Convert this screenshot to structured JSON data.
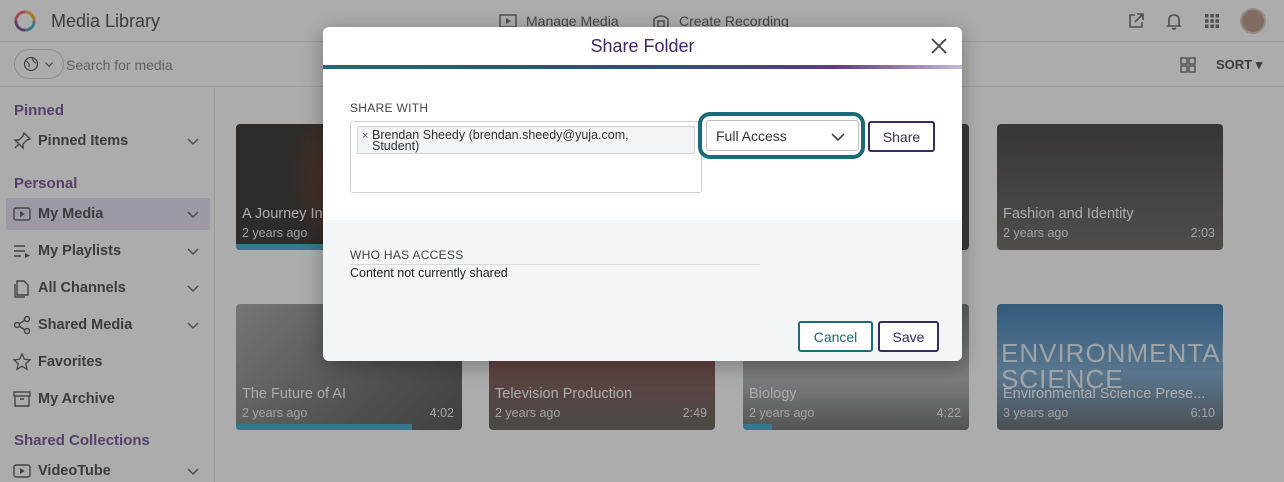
{
  "app": {
    "title": "Media Library",
    "nav": [
      {
        "label": "Manage Media",
        "icon": "manage-media-icon"
      },
      {
        "label": "Create Recording",
        "icon": "create-recording-icon"
      }
    ],
    "top_icons": [
      "external-link-icon",
      "bell-icon",
      "apps-grid-icon",
      "avatar"
    ]
  },
  "search": {
    "placeholder": "Search for media",
    "sort_label": "SORT ▾"
  },
  "sidebar": {
    "sections": [
      {
        "title": "Pinned",
        "items": [
          {
            "label": "Pinned Items",
            "icon": "pin-icon",
            "expandable": true
          }
        ]
      },
      {
        "title": "Personal",
        "items": [
          {
            "label": "My Media",
            "icon": "media-icon",
            "expandable": true,
            "active": true
          },
          {
            "label": "My Playlists",
            "icon": "playlist-icon",
            "expandable": true
          },
          {
            "label": "All Channels",
            "icon": "channels-icon",
            "expandable": true
          },
          {
            "label": "Shared Media",
            "icon": "share-icon",
            "expandable": true
          },
          {
            "label": "Favorites",
            "icon": "star-icon",
            "expandable": false
          },
          {
            "label": "My Archive",
            "icon": "archive-icon",
            "expandable": false
          }
        ]
      },
      {
        "title": "Shared Collections",
        "items": [
          {
            "label": "VideoTube",
            "icon": "videotube-icon",
            "expandable": true
          }
        ]
      }
    ]
  },
  "media_cards": [
    {
      "title": "A Journey In",
      "age": "2 years ago",
      "duration": "",
      "progress": 0.4
    },
    {
      "title": "",
      "age": "",
      "duration": "",
      "progress": 0
    },
    {
      "title": "",
      "age": "",
      "duration": "",
      "progress": 0
    },
    {
      "title": "Fashion and Identity",
      "age": "2 years ago",
      "duration": "2:03",
      "progress": 0
    },
    {
      "title": "The Future of AI",
      "age": "2 years ago",
      "duration": "4:02",
      "progress": 0.78
    },
    {
      "title": "Television Production",
      "age": "2 years ago",
      "duration": "2:49",
      "progress": 0
    },
    {
      "title": "Biology",
      "age": "2 years ago",
      "duration": "4:22",
      "progress": 0.13
    },
    {
      "title": "Environmental Science Prese...",
      "age": "3 years ago",
      "duration": "6:10",
      "progress": 0,
      "overlay_text": "ENVIRONMENTAL SCIENCE"
    }
  ],
  "modal": {
    "title": "Share Folder",
    "share_with_label": "SHARE WITH",
    "chip_line1": "Brendan Sheedy (brendan.sheedy@yuja.com,",
    "chip_line2": "Student)",
    "access_value": "Full Access",
    "share_button": "Share",
    "who_has_access_label": "WHO HAS ACCESS",
    "access_status": "Content not currently shared",
    "cancel_button": "Cancel",
    "save_button": "Save"
  },
  "colors": {
    "accent_purple": "#3a2a66",
    "accent_teal": "#1a6b78",
    "progress_blue": "#2da1c7",
    "active_item_bg": "#e8daf2"
  }
}
